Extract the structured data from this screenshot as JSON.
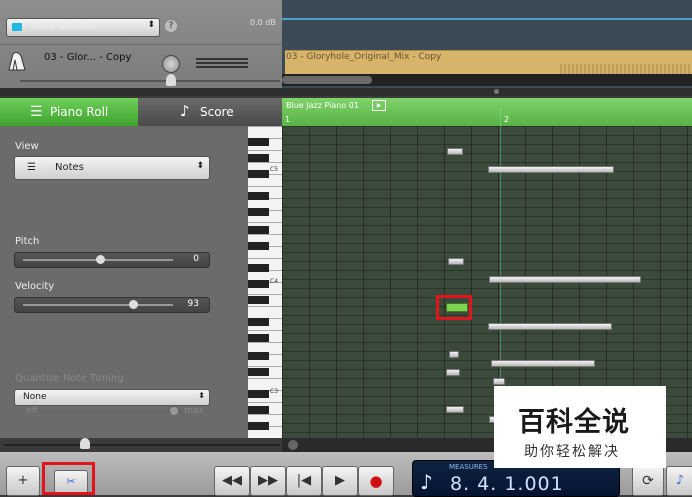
{
  "track_header": {
    "automation_param": "Track Volume",
    "help_glyph": "?",
    "db_readout": "0.0 dB",
    "track_name": "03 - Glor... - Copy"
  },
  "region": {
    "clip_label": "03 - Gloryhole_Original_Mix - Copy",
    "midi_region_name": "Blue Jazz Piano 01",
    "play_glyph": "▶",
    "ruler": [
      "1",
      "2"
    ]
  },
  "editor_tabs": {
    "piano_roll": "Piano Roll",
    "score": "Score"
  },
  "inspector": {
    "view_label": "View",
    "view_value": "Notes",
    "pitch_label": "Pitch",
    "pitch_value": "0",
    "velocity_label": "Velocity",
    "velocity_value": "93",
    "quantize_label": "Quantize Note Timing",
    "quantize_value": "None",
    "off_label": "off",
    "max_label": "max"
  },
  "keyboard_labels": [
    "C5",
    "C4",
    "C3"
  ],
  "transport": {
    "add_glyph": "+",
    "rewind_glyph": "◀◀",
    "ffwd_glyph": "▶▶",
    "to_start_glyph": "|◀",
    "play_glyph": "▶",
    "record_glyph": "●",
    "lcd_mode": "MEASURES",
    "lcd_note": "♪",
    "lcd_value": "8. 4. 1.001",
    "cycle_glyph": "⟳",
    "tuner_glyph": "♪"
  },
  "watermark": {
    "main": "百科全说",
    "sub": "助你轻松解决"
  },
  "colors": {
    "accent_green": "#5ec04a",
    "highlight_red": "#e2141c",
    "lcd_bg": "#0e2242"
  }
}
